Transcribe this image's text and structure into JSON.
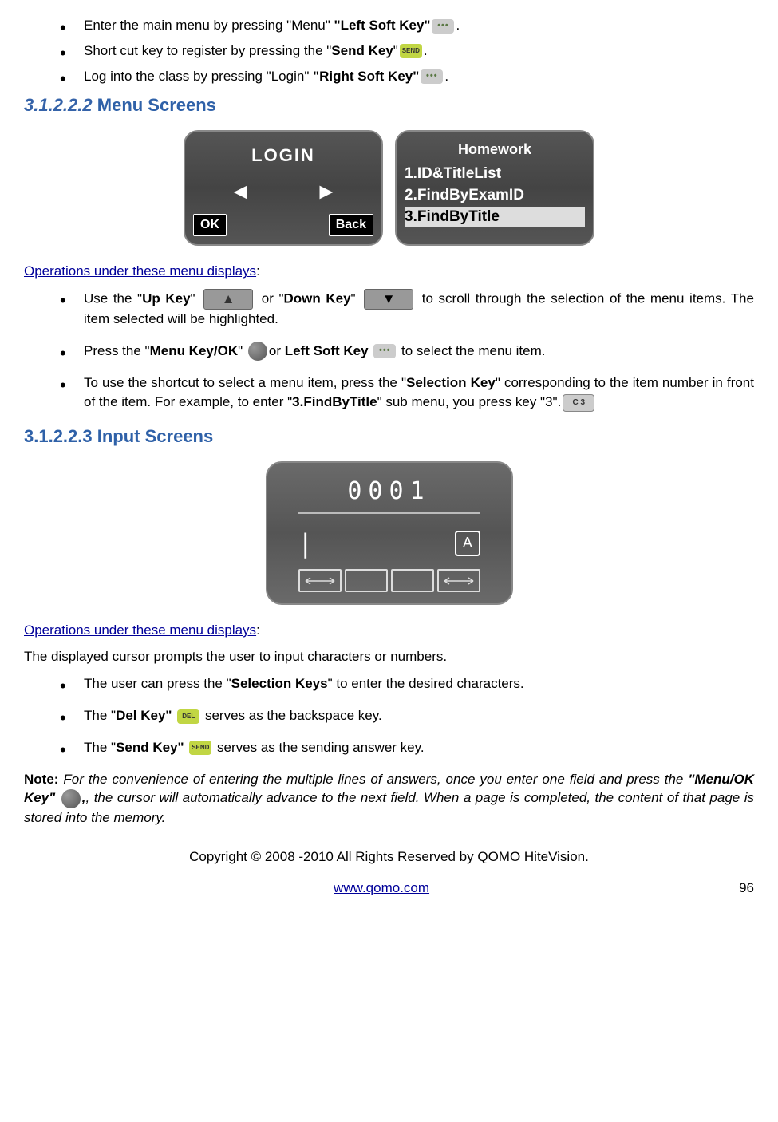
{
  "bullets_top": [
    {
      "pre": "Enter the main menu by pressing \"Menu\" ",
      "bold": "\"Left Soft Key\"",
      "icon": "soft",
      "post": "."
    },
    {
      "pre": "Short cut key to register by pressing the \"",
      "bold": "Send Key",
      "post": "\"",
      "icon": "send",
      "post2": "."
    },
    {
      "pre": "Log into the class by pressing \"Login\" ",
      "bold": "\"Right Soft Key\"",
      "icon": "soft",
      "post": "."
    }
  ],
  "h1_num": "3.1.2.2.2",
  "h1_txt": "  Menu Screens",
  "login_screen": {
    "title": "LOGIN",
    "ok": "OK",
    "back": "Back"
  },
  "hw_screen": {
    "title": "Homework",
    "l1": "1.ID&TitleList",
    "l2": "2.FindByExamID",
    "l3": "3.FindByTitle"
  },
  "ops_link": "Operations under these menu displays",
  "colon": ":",
  "b_upkey_pre": "Use the \"",
  "b_upkey": "Up Key",
  "b_upkey_mid": "\" ",
  "b_downkey_or": " or \"",
  "b_downkey": "Down Key",
  "b_downkey_post": "\" ",
  "b_scroll": " to scroll through the selection of the menu items. The item selected will be highlighted.",
  "b_press_pre": "Press the \"",
  "b_menukey": "Menu Key/OK",
  "b_press_mid": "\" ",
  "b_leftsoft_or": "or ",
  "b_leftsoft": "Left Soft Key ",
  "b_select": " to select the menu item.",
  "b_shortcut_pre": "To use the shortcut to select a menu item, press the \"",
  "b_selkey": "Selection Key",
  "b_shortcut_mid": "\" corresponding to the item number in front of the item. For example, to enter \"",
  "b_findtitle": "3.FindByTitle",
  "b_shortcut_post": "\" sub menu, you press key \"3\".",
  "key3": "C  3",
  "h2_num": "3.1.2.2.3",
  "h2_txt": "  Input Screens",
  "input_num": "0001",
  "input_a": "A",
  "p_cursor": "The displayed cursor prompts the user to input characters or numbers.",
  "b_selkeys_pre": "The user can press the \"",
  "b_selkeys": "Selection Keys",
  "b_selkeys_post": "\" to enter the desired characters.",
  "b_delkey_pre": "The \"",
  "b_delkey": "Del Key\"",
  "b_delkey_post": " serves as the backspace key.",
  "b_sendkey_pre": "The \"",
  "b_sendkey": "Send Key\"",
  "b_sendkey_post": " serves as the sending answer key.",
  "note_label": "Note: ",
  "note_1": "For the convenience of entering the multiple lines of answers, once you enter one field and press the ",
  "note_menuok": "\"Menu/OK Key\" ",
  "note_2": ", the cursor will automatically advance to the next field. When a page is completed, the content of that page is stored into the memory.",
  "copyright": "Copyright © 2008 -2010 All Rights Reserved by QOMO HiteVision.",
  "url": "www.qomo.com",
  "page": "96",
  "send_txt": "SEND",
  "del_txt": "DEL",
  "menu_txt": "MENU OK"
}
